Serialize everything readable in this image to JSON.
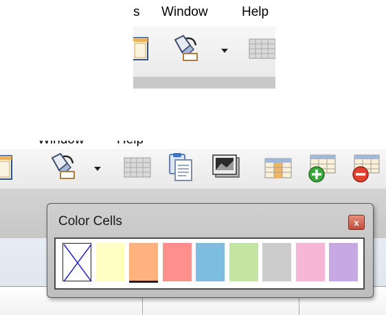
{
  "top_crop": {
    "menu": {
      "partial_item": "s",
      "window_label": "Window",
      "help_label": "Help"
    }
  },
  "bottom_crop": {
    "menu": {
      "window_label": "Window",
      "help_label": "Help"
    }
  },
  "palette": {
    "title": "Color Cells",
    "close_glyph": "x",
    "swatches": [
      {
        "name": "no-color",
        "color": "#ffffff"
      },
      {
        "name": "yellow",
        "color": "#ffffc4"
      },
      {
        "name": "orange",
        "color": "#ffb17e",
        "selected": true
      },
      {
        "name": "red",
        "color": "#ff8f8c"
      },
      {
        "name": "blue",
        "color": "#7cbde0"
      },
      {
        "name": "green",
        "color": "#c4e5a2"
      },
      {
        "name": "gray",
        "color": "#cccccc"
      },
      {
        "name": "pink",
        "color": "#f6b7d7"
      },
      {
        "name": "purple",
        "color": "#c6a8e2"
      }
    ]
  },
  "icons": [
    "document-icon",
    "paint-bucket-icon",
    "dropdown-arrow-icon",
    "table-grid-icon",
    "paste-icon",
    "image-icon",
    "table-columns-icon",
    "insert-table-icon",
    "delete-table-icon"
  ]
}
